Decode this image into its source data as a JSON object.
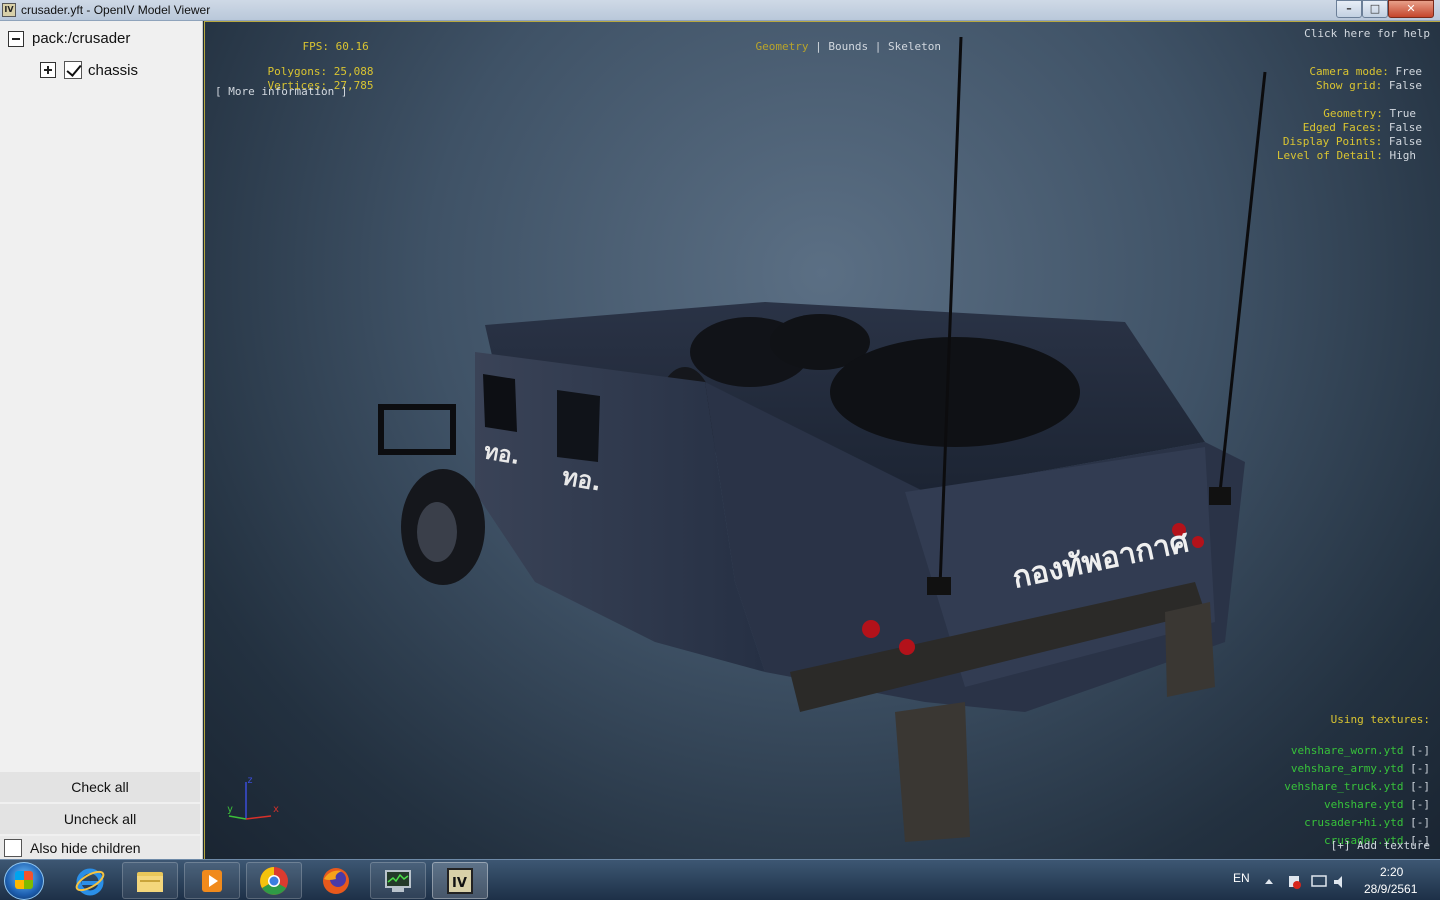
{
  "window": {
    "title": "crusader.yft - OpenIV Model Viewer",
    "app_icon": "IV",
    "buttons": [
      "minimize",
      "maximize",
      "close"
    ]
  },
  "sidebar": {
    "tree": [
      {
        "label": "pack:/crusader",
        "expander": "minus"
      },
      {
        "label": "chassis",
        "expander": "plus",
        "checked": true
      }
    ],
    "check_all": "Check all",
    "uncheck_all": "Uncheck all",
    "also_hide_children": "Also hide children"
  },
  "hud": {
    "fps_label": "FPS:",
    "fps_value": "60.16",
    "polygons_label": "Polygons:",
    "polygons_value": "25,088",
    "vertices_label": "Vertices:",
    "vertices_value": "27,785",
    "more_info": "[ More information ]",
    "modes": [
      "Geometry",
      "Bounds",
      "Skeleton"
    ],
    "mode_sep": "|",
    "help": "Click here for help",
    "settings": [
      {
        "label": "Camera mode:",
        "value": "Free"
      },
      {
        "label": "Show grid:",
        "value": "False"
      },
      {
        "label": "Geometry:",
        "value": "True"
      },
      {
        "label": "Edged Faces:",
        "value": "False"
      },
      {
        "label": "Display Points:",
        "value": "False"
      },
      {
        "label": "Level of Detail:",
        "value": "High"
      }
    ],
    "textures_title": "Using textures:",
    "textures": [
      "vehshare_worn.ytd",
      "vehshare_army.ytd",
      "vehshare_truck.ytd",
      "vehshare.ytd",
      "crusader+hi.ytd",
      "crusader.ytd"
    ],
    "remove": "[-]",
    "add_texture": "[+] Add texture",
    "axis": {
      "z": "z",
      "y": "y",
      "x": "x"
    }
  },
  "model": {
    "side_text_1": "ทอ.",
    "side_text_2": "ทอ.",
    "rear_text": "กองทัพอากาศ"
  },
  "taskbar": {
    "apps": [
      "internet-explorer",
      "file-explorer",
      "media-player",
      "chrome",
      "firefox",
      "system-monitor",
      "openiv"
    ],
    "lang": "EN",
    "time": "2:20",
    "date": "28/9/2561"
  },
  "colors": {
    "hud_label": "#d9c431",
    "hud_value": "#d2d8df",
    "texture_green": "#37c23a"
  }
}
